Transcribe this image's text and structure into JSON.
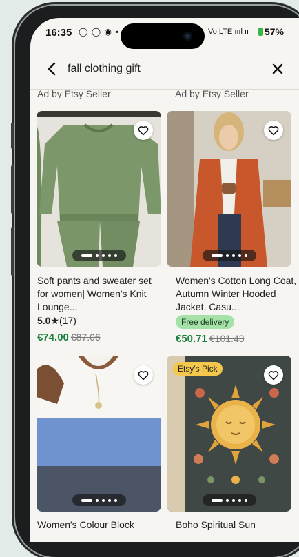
{
  "status_bar": {
    "time": "16:35",
    "apps": "◯ ◯ ◉ ▪",
    "network": "Vo LTE ıııl ıı",
    "battery": "57%"
  },
  "search": {
    "query": "fall clothing gift"
  },
  "ad_labels": [
    "Ad by Etsy Seller",
    "Ad by Etsy Seller"
  ],
  "listings": [
    {
      "title": "Soft pants and sweater set for women| Women's Knit Lounge...",
      "rating": "5.0",
      "review_count": "(17)",
      "price": "€74.00",
      "original_price": "€87.06",
      "image_colors": [
        "#7c986a",
        "#e9e7e2"
      ]
    },
    {
      "title": "Women's Cotton Long Coat, Autumn Winter Hooded Jacket, Casu...",
      "badge": "Free delivery",
      "price": "€50.71",
      "original_price": "€101.43",
      "image_colors": [
        "#c8582c",
        "#cfc7ba"
      ]
    },
    {
      "title": "Women's Colour Block",
      "image_colors": [
        "#5e86c8",
        "#f4f2ec"
      ]
    },
    {
      "title": "Boho Spiritual Sun",
      "badge": "Etsy's Pick",
      "image_colors": [
        "#3a4440",
        "#e2a33a"
      ]
    }
  ],
  "accent_colors": {
    "price_green": "#1a7f3c",
    "free_delivery_bg": "#a4e2a7",
    "etsys_pick_bg": "#f5c84c"
  }
}
